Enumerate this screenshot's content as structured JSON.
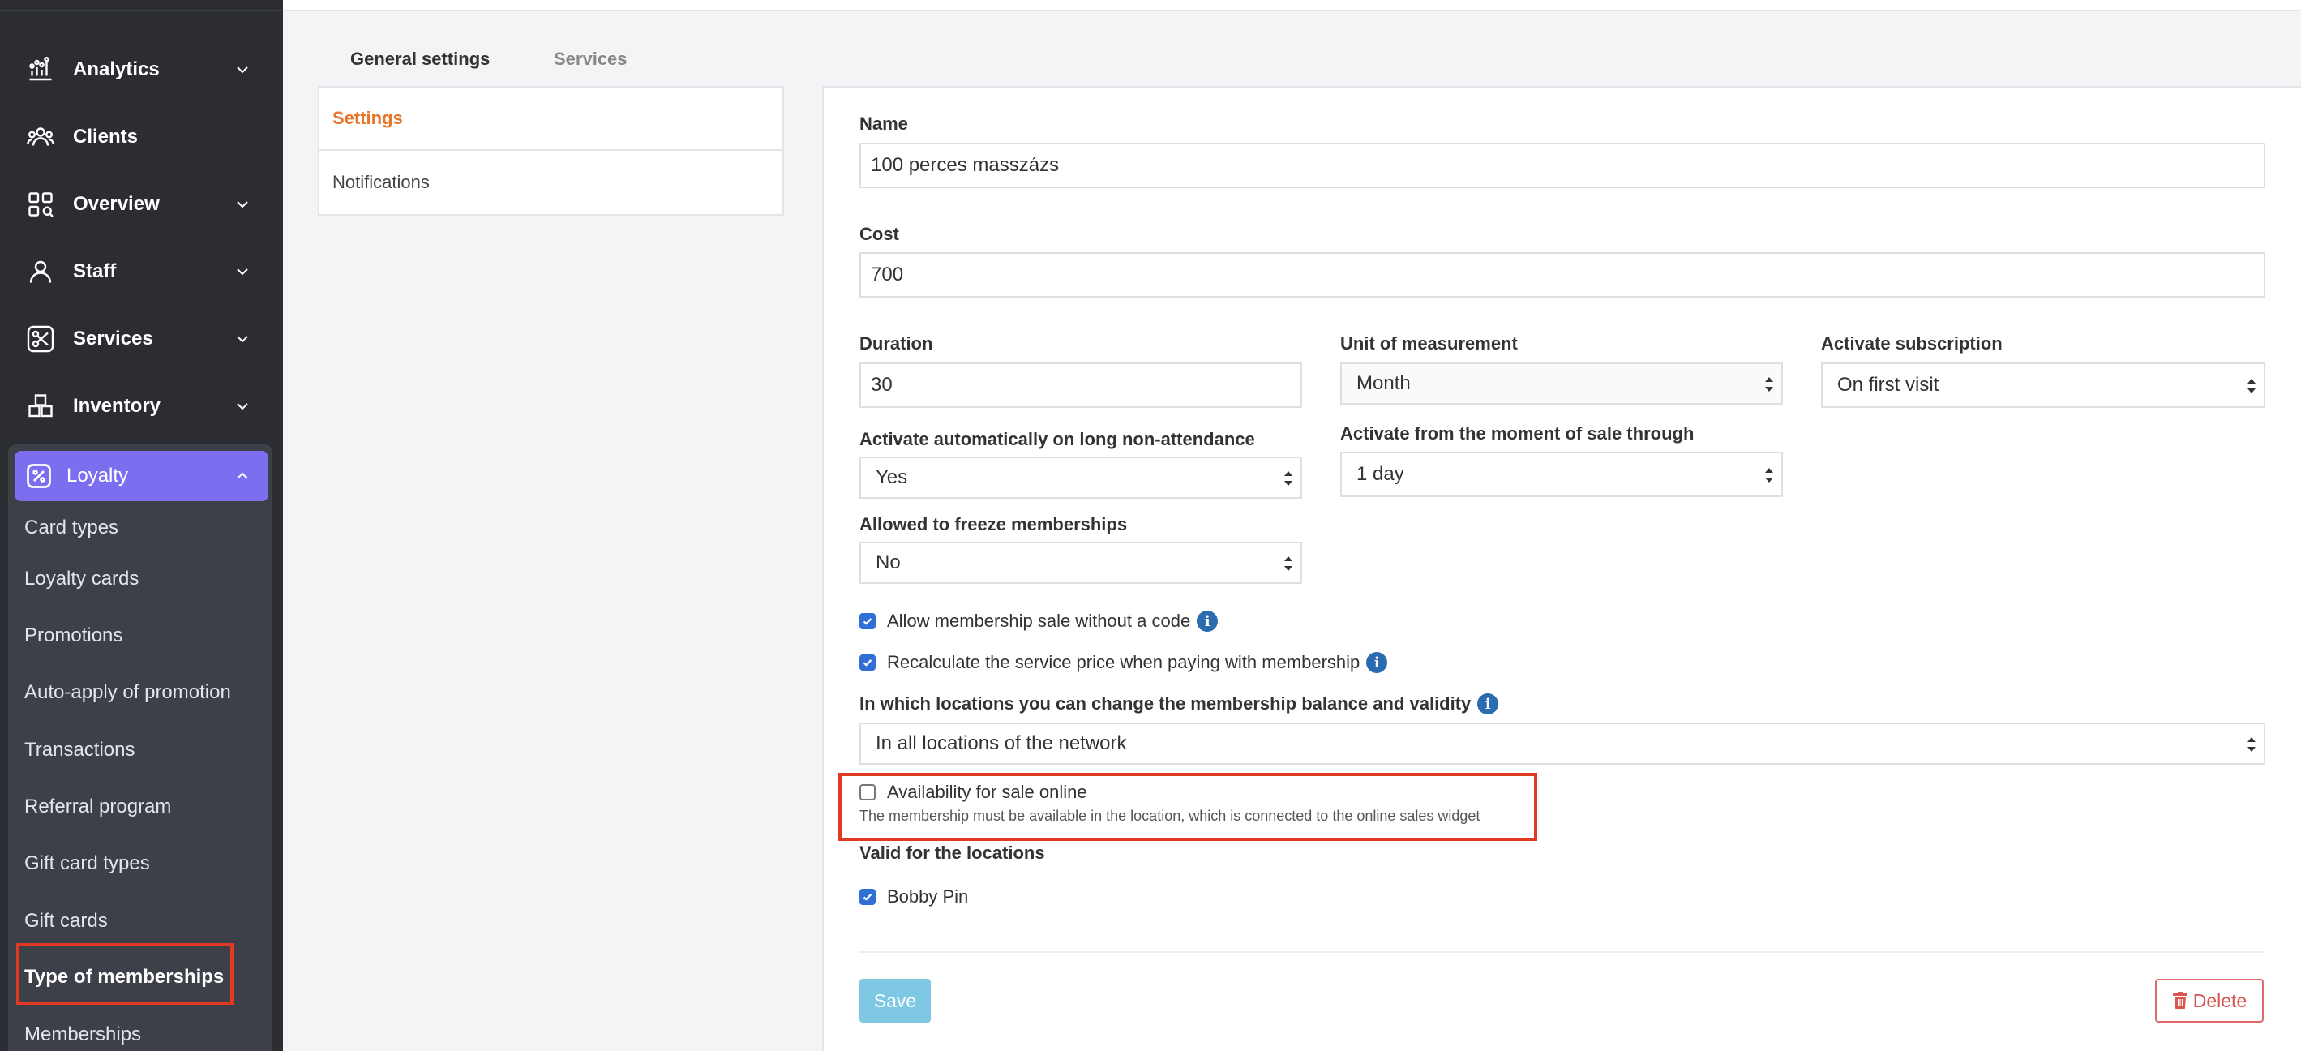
{
  "sidebar": {
    "items": [
      {
        "label": "Analytics",
        "icon": "analytics-icon"
      },
      {
        "label": "Clients",
        "icon": "clients-icon"
      },
      {
        "label": "Overview",
        "icon": "overview-icon"
      },
      {
        "label": "Staff",
        "icon": "staff-icon"
      },
      {
        "label": "Services",
        "icon": "services-icon"
      },
      {
        "label": "Inventory",
        "icon": "inventory-icon"
      }
    ],
    "loyalty": {
      "label": "Loyalty",
      "subitems": [
        "Card types",
        "Loyalty cards",
        "Promotions",
        "Auto-apply of promotion",
        "Transactions",
        "Referral program",
        "Gift card types",
        "Gift cards",
        "Type of memberships",
        "Memberships"
      ]
    }
  },
  "tabs": {
    "general": "General settings",
    "services": "Services"
  },
  "subnav": {
    "settings": "Settings",
    "notifications": "Notifications"
  },
  "form": {
    "name_label": "Name",
    "name_value": "100 perces masszázs",
    "cost_label": "Cost",
    "cost_value": "700",
    "duration_label": "Duration",
    "duration_value": "30",
    "unit_label": "Unit of measurement",
    "unit_value": "Month",
    "activate_sub_label": "Activate subscription",
    "activate_sub_value": "On first visit",
    "auto_activate_label": "Activate automatically on long non-attendance",
    "auto_activate_value": "Yes",
    "activate_from_label": "Activate from the moment of sale through",
    "activate_from_value": "1 day",
    "freeze_label": "Allowed to freeze memberships",
    "freeze_value": "No",
    "allow_sale_label": "Allow membership sale without a code",
    "recalc_label": "Recalculate the service price when paying with membership",
    "locations_change_label": "In which locations you can change the membership balance and validity",
    "locations_change_value": "In all locations of the network",
    "online_label": "Availability for sale online",
    "online_hint": "The membership must be available in the location, which is connected to the online sales widget",
    "valid_locations_label": "Valid for the locations",
    "location_name": "Bobby Pin",
    "info_glyph": "i"
  },
  "buttons": {
    "save": "Save",
    "delete": "Delete"
  },
  "colors": {
    "sidebar_bg": "#2b2d33",
    "accent_purple": "#7b6ff0",
    "accent_orange": "#e8752a",
    "highlight_red": "#e23a22",
    "checkbox_blue": "#2f6fd6",
    "save_button": "#7ec8e3",
    "delete_red": "#d9534f"
  }
}
